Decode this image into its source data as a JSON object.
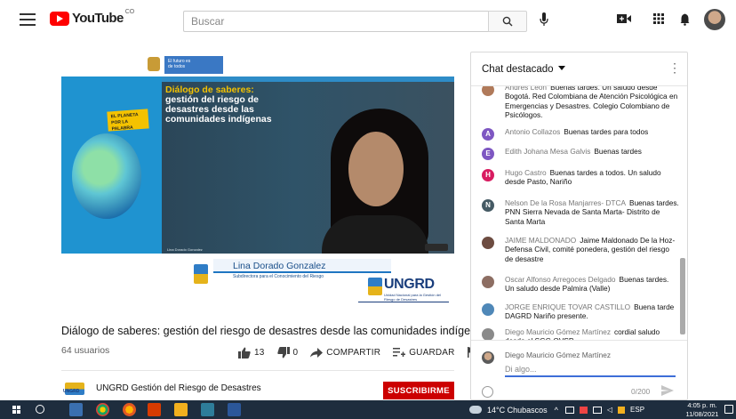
{
  "header": {
    "logo_text": "YouTube",
    "logo_country": "CO",
    "search_placeholder": "Buscar"
  },
  "video": {
    "strip_text": "El futuro es de todos",
    "tag_text": "EL PLANETA POR LA PALABRA",
    "frame_title_line1": "Diálogo de saberes:",
    "frame_title_rest": "gestión del riesgo de desastres desde las comunidades indígenas",
    "frame_credit": "Lina Dorado Gonzalez",
    "lower_name": "Lina Dorado Gonzalez",
    "lower_sub": "Subdirectora para el Conocimiento del Riesgo",
    "org_logo": "UNGRD",
    "org_sub": "Unidad Nacional para la Gestión del Riesgo de Desastres"
  },
  "page": {
    "title": "Diálogo de saberes: gestión del riesgo de desastres desde las comunidades indígenas.",
    "views": "64 usuarios",
    "likes": "13",
    "dislikes": "0",
    "share_label": "COMPARTIR",
    "save_label": "GUARDAR",
    "channel_logo_text": "UNGRD",
    "channel_name": "UNGRD Gestión del Riesgo de Desastres",
    "subscribe_label": "SUSCRIBIRME"
  },
  "chat": {
    "title": "Chat destacado",
    "messages": [
      {
        "author": "Andres Leon",
        "text": "Buenas tardes. Un saludo desde Bogotá. Red Colombiana de Atención Psicológica en Emergencias y Desastres. Colegio Colombiano de Psicólogos.",
        "avatar": "",
        "color": "#b07a5a"
      },
      {
        "author": "Antonio Collazos",
        "text": "Buenas tardes para todos",
        "avatar": "A",
        "color": "#7e57c2"
      },
      {
        "author": "Edith Johana Mesa Galvis",
        "text": "Buenas tardes",
        "avatar": "E",
        "color": "#7e57c2"
      },
      {
        "author": "Hugo Castro",
        "text": "Buenas tardes a todos. Un saludo desde Pasto, Nariño",
        "avatar": "H",
        "color": "#d81b60"
      },
      {
        "author": "Nelson De la Rosa Manjarres- DTCA",
        "text": "Buenas tardes. PNN Sierra Nevada de Santa Marta- Distrito de Santa Marta",
        "avatar": "N",
        "color": "#455a64"
      },
      {
        "author": "JAIME MALDONADO",
        "text": "Jaime Maldonado De la Hoz-Defensa Civil, comité ponedera, gestión del riesgo de desastre",
        "avatar": "",
        "color": "#6d4c41"
      },
      {
        "author": "Oscar Alfonso Arregoces Delgado",
        "text": "Buenas tardes. Un saludo desde Palmira (Valle)",
        "avatar": "",
        "color": "#8d6e63"
      },
      {
        "author": "JORGE ENRIQUE TOVAR CASTILLO",
        "text": "Buena tarde DAGRD Nariño presente.",
        "avatar": "",
        "color": "#4f88b8"
      },
      {
        "author": "Diego Mauricio Gómez Martínez",
        "text": "cordial saludo desde el SGC-OVSP",
        "avatar": "",
        "color": "#8a8a8a"
      }
    ],
    "input_name": "Diego Mauricio Gómez Martínez",
    "input_placeholder": "Di algo...",
    "char_count": "0/200"
  },
  "taskbar": {
    "weather": "14°C  Chubascos",
    "lang": "ESP",
    "time": "4:05 p. m.",
    "date": "11/08/2021"
  }
}
